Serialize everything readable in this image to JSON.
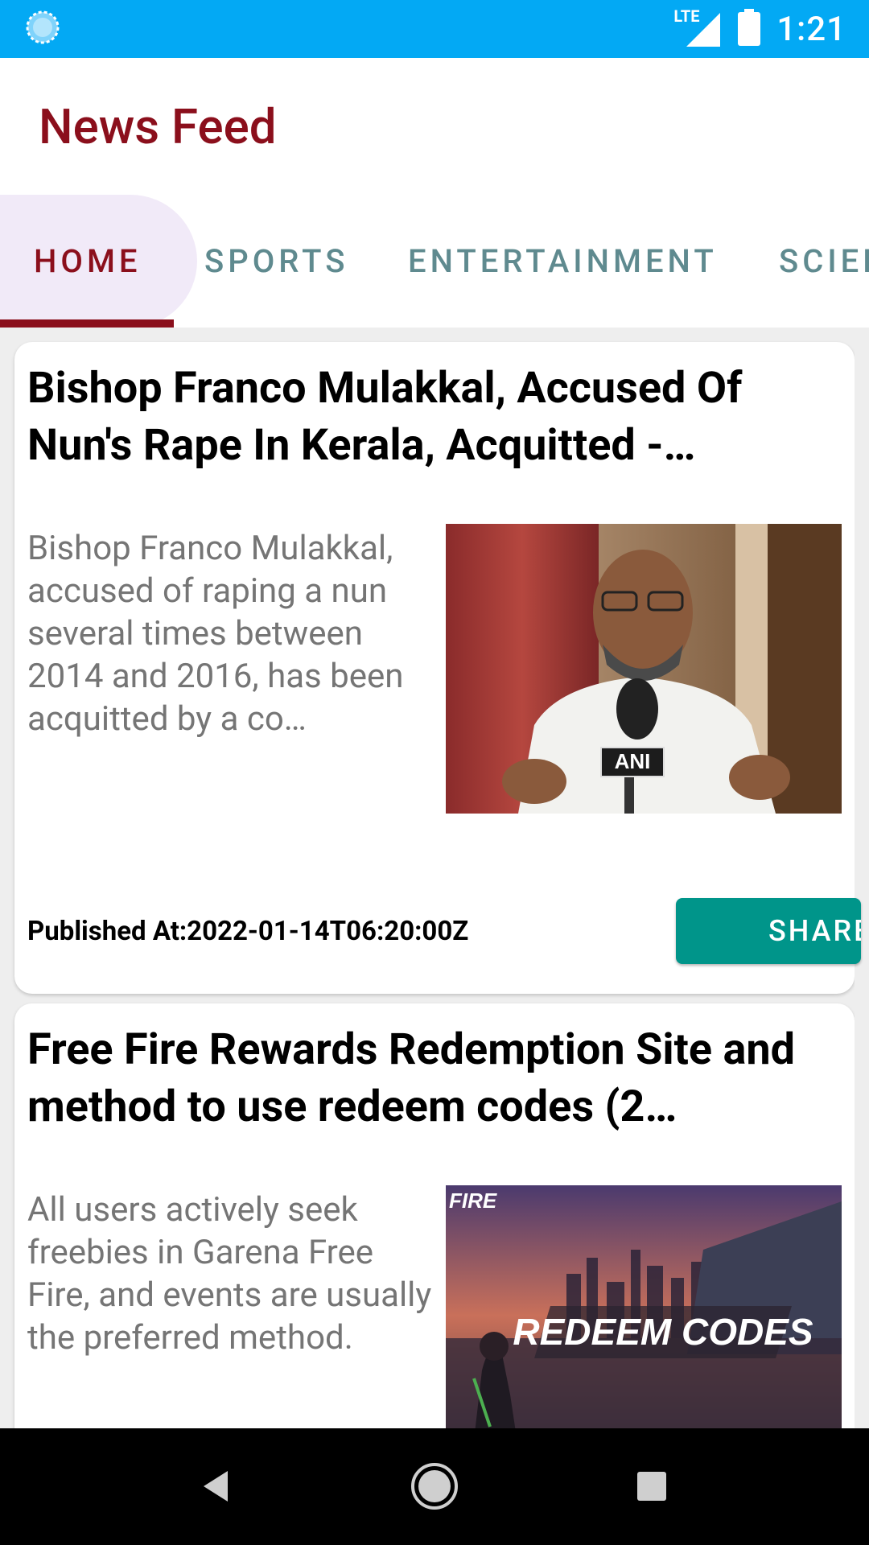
{
  "status_bar": {
    "network": "LTE",
    "time": "1:21"
  },
  "app": {
    "title": "News Feed"
  },
  "tabs": [
    {
      "label": "HOME",
      "active": true
    },
    {
      "label": "SPORTS",
      "active": false
    },
    {
      "label": "ENTERTAINMENT",
      "active": false
    },
    {
      "label": "SCIENCE",
      "active": false
    }
  ],
  "articles": [
    {
      "headline": "Bishop Franco Mulakkal, Accused Of Nun's Rape In Kerala, Acquitted -…",
      "description": "Bishop Franco Mulakkal, accused of raping a nun several times between 2014 and 2016, has been acquitted by a co…",
      "image_label": "ANI",
      "published": "Published At:2022-01-14T06:20:00Z",
      "share_label": "SHARE"
    },
    {
      "headline": "Free Fire Rewards Redemption Site and method to use redeem codes (2…",
      "description": "All users actively seek freebies in Garena Free Fire, and events are usually the preferred method.",
      "image_caption": "REDEEM CODES",
      "image_logo": "FIRE"
    }
  ],
  "colors": {
    "status_bar": "#03a9f4",
    "brand": "#8b0f1c",
    "tab_inactive": "#5f8a8f",
    "share_button": "#00958a"
  },
  "nav": [
    "back-icon",
    "home-icon",
    "recents-icon"
  ]
}
